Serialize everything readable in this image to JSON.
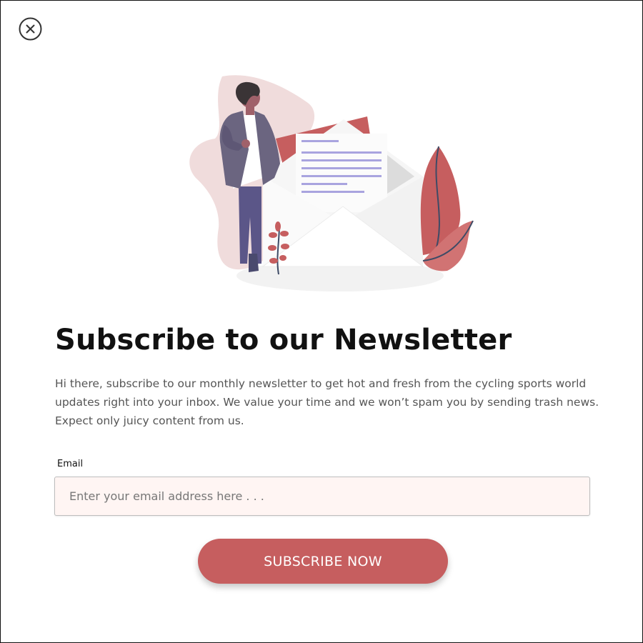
{
  "modal": {
    "close_icon": "close-circle-icon",
    "illustration_icon": "newsletter-envelope-illustration"
  },
  "content": {
    "title": "Subscribe to our Newsletter",
    "description": "Hi there, subscribe to our monthly newsletter to get hot and fresh from the cycling sports world updates right into your inbox. We value your time and we won’t spam you by sending trash news. Expect only juicy content from us."
  },
  "form": {
    "email_label": "Email",
    "email_value": "",
    "email_placeholder": "Enter your email address here . . .",
    "submit_label": "SUBSCRIBE NOW"
  },
  "colors": {
    "accent": "#c65e5f",
    "input_bg": "#fff5f3",
    "title": "#111111",
    "text": "#555555"
  }
}
